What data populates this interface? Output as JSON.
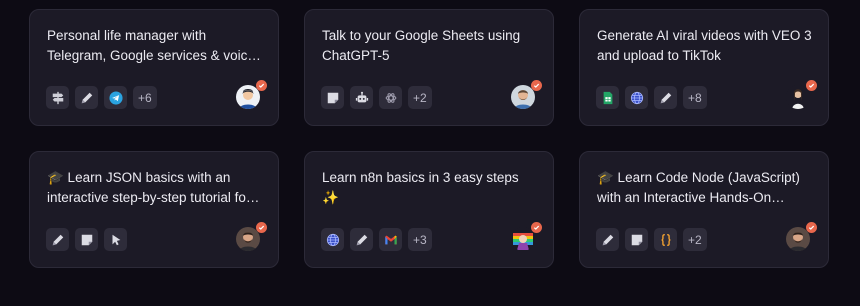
{
  "templates": [
    {
      "title": "Personal life manager with Telegram, Google services & voice-enabled AI",
      "more": "+6",
      "icons": [
        "signpost-icon",
        "pencil-icon",
        "telegram-icon"
      ]
    },
    {
      "title": "Talk to your Google Sheets using ChatGPT-5",
      "more": "+2",
      "icons": [
        "sticky-note-icon",
        "robot-icon",
        "openai-icon"
      ]
    },
    {
      "title": "Generate AI viral videos with VEO 3 and upload to TikTok",
      "more": "+8",
      "icons": [
        "google-sheets-icon",
        "globe-icon",
        "pencil-icon"
      ]
    },
    {
      "title": "🎓 Learn JSON basics with an interactive step-by-step tutorial for beginners",
      "more": "",
      "icons": [
        "pencil-icon",
        "sticky-note-icon",
        "cursor-icon"
      ]
    },
    {
      "title": "Learn n8n basics in 3 easy steps ✨",
      "more": "+3",
      "icons": [
        "globe-icon",
        "pencil-icon",
        "gmail-icon"
      ]
    },
    {
      "title": "🎓 Learn Code Node (JavaScript) with an Interactive Hands-On Tutorial",
      "more": "+2",
      "icons": [
        "pencil-icon",
        "sticky-note-icon",
        "code-braces-icon"
      ]
    }
  ],
  "colors": {
    "background": "#0d0b14",
    "card": "#1c1a26",
    "badge": "#e8674c"
  }
}
